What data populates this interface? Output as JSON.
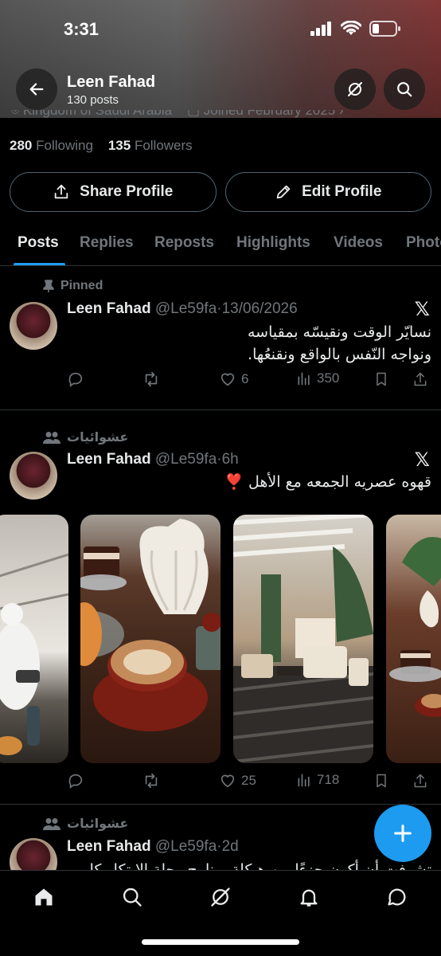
{
  "status_bar": {
    "time": "3:31"
  },
  "header": {
    "name": "Leen Fahad",
    "posts_count": "130 posts"
  },
  "profile": {
    "location": "Kingdom of Saudi Arabia",
    "joined": "Joined February 2025",
    "following_count": "280",
    "following_label": "Following",
    "followers_count": "135",
    "followers_label": "Followers",
    "share_label": "Share Profile",
    "edit_label": "Edit Profile"
  },
  "tabs": [
    "Posts",
    "Replies",
    "Reposts",
    "Highlights",
    "Videos",
    "Photos"
  ],
  "posts": [
    {
      "context": "Pinned",
      "name": "Leen Fahad",
      "handle": "@Le59fa",
      "time": "13/06/2026",
      "text_lines": [
        "نسايّر الوقت ونقيسّه بمقياسه",
        "ونواجه النّفس بالواقع ونقنعُها."
      ],
      "likes": "6",
      "views": "350"
    },
    {
      "context": "عشوائيات",
      "name": "Leen Fahad",
      "handle": "@Le59fa",
      "time": "6h",
      "text_lines": [
        "قهوه عصريه الجمعه مع الأهل ❣️"
      ],
      "likes": "25",
      "views": "718"
    },
    {
      "context": "عشوائيات",
      "name": "Leen Fahad",
      "handle": "@Le59fa",
      "time": "2d",
      "text_lines": [
        "تشوفت أن أكون جزءًا من هيكلة برنامج رحلة الابتكار كل"
      ]
    }
  ],
  "icons": {
    "back": "arrow-left-icon",
    "grok": "grok-icon",
    "search": "search-icon",
    "x_logo": "x-logo-icon",
    "compose": "plus-icon"
  },
  "colors": {
    "accent": "#1d9bf0",
    "muted": "#71767b",
    "border": "#2f3336"
  }
}
